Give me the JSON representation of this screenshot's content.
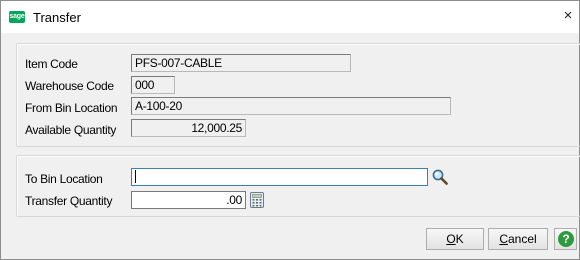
{
  "window": {
    "title": "Transfer",
    "logo_text": "sage",
    "close_glyph": "×"
  },
  "item_info": {
    "item_code_label": "Item Code",
    "item_code_value": "PFS-007-CABLE",
    "warehouse_code_label": "Warehouse Code",
    "warehouse_code_value": "000",
    "from_bin_label": "From Bin Location",
    "from_bin_value": "A-100-20",
    "available_qty_label": "Available Quantity",
    "available_qty_value": "12,000.25"
  },
  "transfer": {
    "to_bin_label": "To Bin Location",
    "to_bin_value": "",
    "transfer_qty_label": "Transfer Quantity",
    "transfer_qty_value": ".00",
    "lookup_icon": "search-icon",
    "calculator_icon": "calculator-icon"
  },
  "buttons": {
    "ok_mnemonic": "O",
    "ok_rest": "K",
    "cancel_mnemonic": "C",
    "cancel_rest": "ancel",
    "help_glyph": "?"
  },
  "colors": {
    "brand": "#00a65a",
    "help": "#2e9a3d",
    "focus_border": "#3c7fb1"
  }
}
